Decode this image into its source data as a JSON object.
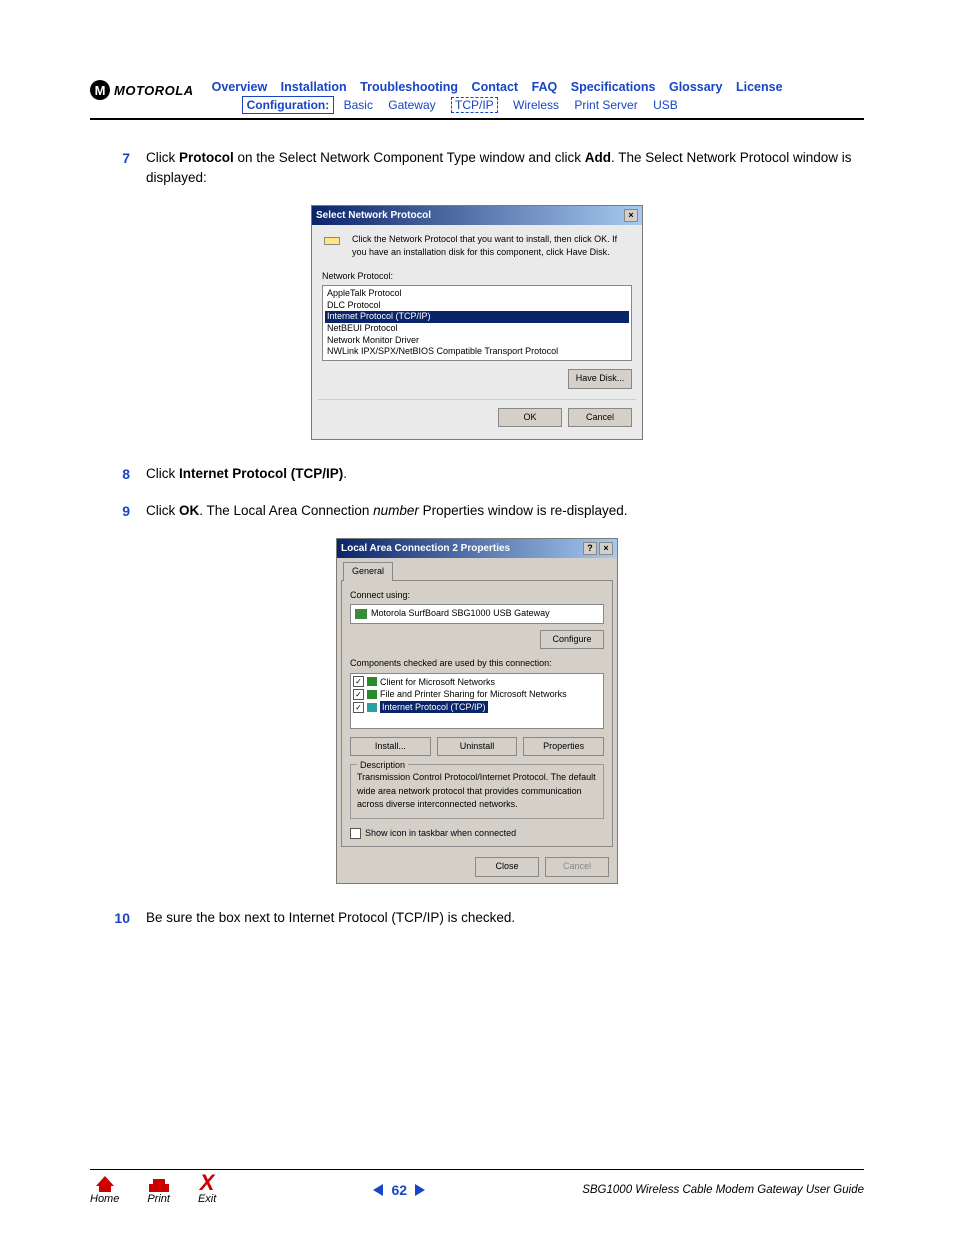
{
  "logo_text": "MOTOROLA",
  "nav_top": [
    "Overview",
    "Installation",
    "Troubleshooting",
    "Contact",
    "FAQ",
    "Specifications",
    "Glossary",
    "License"
  ],
  "nav_sub_label": "Configuration:",
  "nav_sub": [
    "Basic",
    "Gateway",
    "TCP/IP",
    "Wireless",
    "Print Server",
    "USB"
  ],
  "steps": {
    "s7": {
      "num": "7",
      "prefix": "Click ",
      "b1": "Protocol",
      "mid": " on the Select Network Component Type window and click ",
      "b2": "Add",
      "suffix": ". The Select Network Protocol window is displayed:"
    },
    "s8": {
      "num": "8",
      "prefix": "Click ",
      "b1": "Internet Protocol (TCP/IP)",
      "suffix": "."
    },
    "s9": {
      "num": "9",
      "prefix": "Click ",
      "b1": "OK",
      "mid": ". The Local Area Connection ",
      "it": "number",
      "suffix": " Properties window is re-displayed."
    },
    "s10": {
      "num": "10",
      "text": "Be sure the box next to Internet Protocol (TCP/IP) is checked."
    }
  },
  "dlg1": {
    "title": "Select Network Protocol",
    "instr": "Click the Network Protocol that you want to install, then click OK. If you have an installation disk for this component, click Have Disk.",
    "label": "Network Protocol:",
    "items": [
      "AppleTalk Protocol",
      "DLC Protocol",
      "Internet Protocol (TCP/IP)",
      "NetBEUI Protocol",
      "Network Monitor Driver",
      "NWLink IPX/SPX/NetBIOS Compatible Transport Protocol"
    ],
    "have_disk": "Have Disk...",
    "ok": "OK",
    "cancel": "Cancel"
  },
  "dlg2": {
    "title": "Local Area Connection 2 Properties",
    "tab": "General",
    "connect_label": "Connect using:",
    "device": "Motorola SurfBoard SBG1000 USB Gateway",
    "configure": "Configure",
    "components_label": "Components checked are used by this connection:",
    "comps": [
      "Client for Microsoft Networks",
      "File and Printer Sharing for Microsoft Networks",
      "Internet Protocol (TCP/IP)"
    ],
    "install": "Install...",
    "uninstall": "Uninstall",
    "properties": "Properties",
    "desc_label": "Description",
    "desc": "Transmission Control Protocol/Internet Protocol. The default wide area network protocol that provides communication across diverse interconnected networks.",
    "show_icon": "Show icon in taskbar when connected",
    "close": "Close",
    "cancel": "Cancel"
  },
  "footer": {
    "home": "Home",
    "print": "Print",
    "exit": "Exit",
    "page": "62",
    "guide": "SBG1000 Wireless Cable Modem Gateway User Guide"
  }
}
